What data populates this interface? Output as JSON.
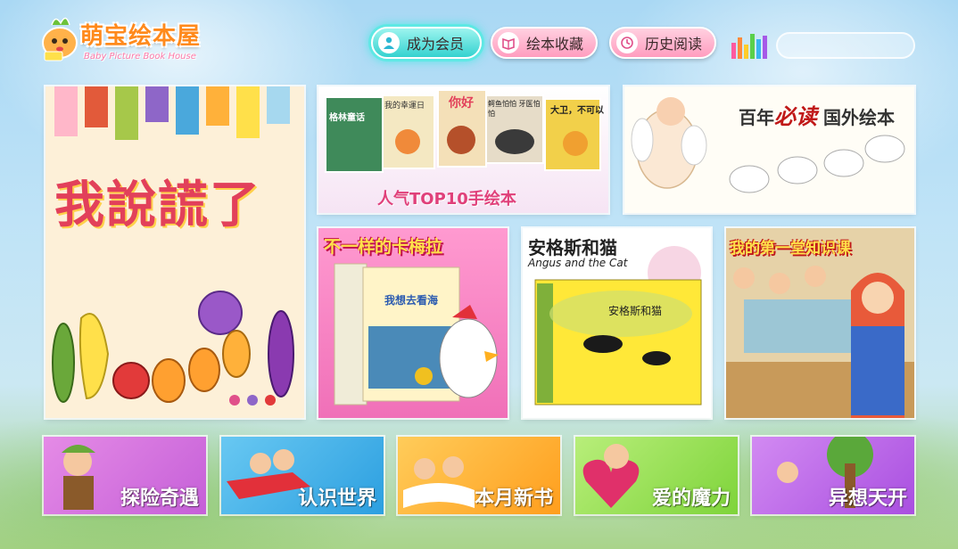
{
  "logo": {
    "title": "萌宝绘本屋",
    "subtitle": "Baby Picture Book House"
  },
  "nav": {
    "member": "成为会员",
    "favorites": "绘本收藏",
    "history": "历史阅读"
  },
  "tiles": {
    "lie": {
      "title": "我說謊了"
    },
    "top10": {
      "caption": "人气TOP10手绘本",
      "books": [
        "格林童话",
        "我的幸運日",
        "你好",
        "鳄鱼怕怕 牙医怕怕",
        "大卫，不可以"
      ]
    },
    "century": {
      "prefix": "百年",
      "highlight": "必读",
      "suffix": "国外绘本"
    },
    "caillou": {
      "title": "不一样的卡梅拉",
      "book": "我想去看海"
    },
    "angus": {
      "title": "安格斯和猫",
      "subtitle": "Angus and the Cat",
      "book": "安格斯和猫"
    },
    "firstclass": {
      "title": "我的第一堂知识课"
    }
  },
  "categories": [
    {
      "label": "探险奇遇"
    },
    {
      "label": "认识世界"
    },
    {
      "label": "本月新书"
    },
    {
      "label": "爱的魔力"
    },
    {
      "label": "异想天开"
    }
  ],
  "colors": {
    "member_accent": "#34d2d0",
    "nav_pink": "#ff9dbf",
    "logo_orange": "#ff8a1c"
  }
}
